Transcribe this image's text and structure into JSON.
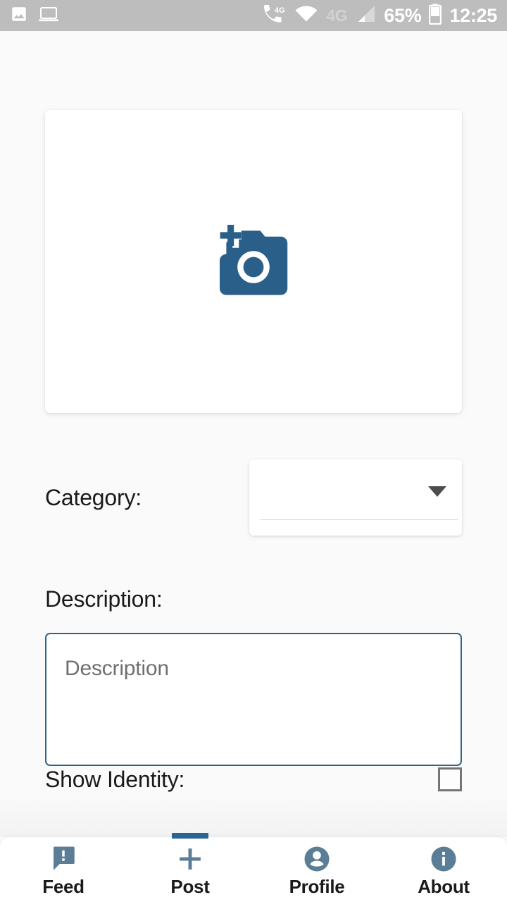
{
  "status_bar": {
    "icons_left": [
      {
        "name": "image-icon",
        "label": "photo"
      },
      {
        "name": "laptop-icon",
        "label": "laptop"
      }
    ],
    "volte_label": "4G",
    "network_label_dim": "4G",
    "battery_percent": "65%",
    "time": "12:25",
    "background_color": "#bdbdbd",
    "foreground_color": "#ffffff"
  },
  "screen": {
    "background_color": "#fafafa"
  },
  "photo_upload": {
    "icon_name": "add-a-photo-icon",
    "icon_color": "#2a5f8a",
    "hint": ""
  },
  "form": {
    "category": {
      "label": "Category:",
      "selected_value": "",
      "placeholder": "",
      "caret_icon": "chevron-down-icon"
    },
    "description": {
      "label": "Description:",
      "value": "",
      "placeholder": "Description",
      "border_color": "#2d6489"
    },
    "show_identity": {
      "label": "Show Identity:",
      "checked": false
    }
  },
  "bottom_nav": {
    "active_index": 1,
    "active_color": "#2b6491",
    "icon_color": "#5b7d96",
    "items": [
      {
        "label": "Feed",
        "icon": "feedback-bubble-icon"
      },
      {
        "label": "Post",
        "icon": "plus-icon"
      },
      {
        "label": "Profile",
        "icon": "account-circle-icon"
      },
      {
        "label": "About",
        "icon": "info-circle-icon"
      }
    ]
  }
}
